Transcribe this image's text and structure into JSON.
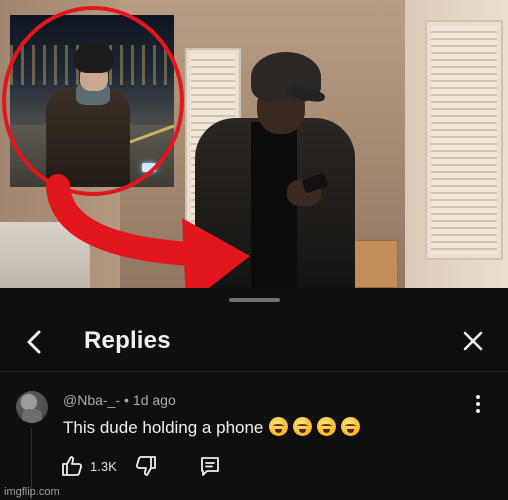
{
  "panel": {
    "title": "Replies"
  },
  "comment": {
    "author": "@Nba-_-",
    "separator": "•",
    "time": "1d ago",
    "text": "This dude holding a phone",
    "emoji_names": [
      "loudly-crying-face",
      "loudly-crying-face",
      "loudly-crying-face",
      "loudly-crying-face"
    ],
    "like_count": "1.3K"
  },
  "watermark": "imgflip.com",
  "colors": {
    "background": "#0f0f0f",
    "annotation_red": "#e3161e",
    "text_primary": "#f1f1f1",
    "text_secondary": "#aaaaaa"
  },
  "icons": {
    "back": "chevron-left-icon",
    "close": "close-icon",
    "menu": "more-vertical-icon",
    "like": "thumb-up-icon",
    "dislike": "thumb-down-icon",
    "reply": "comment-icon"
  }
}
